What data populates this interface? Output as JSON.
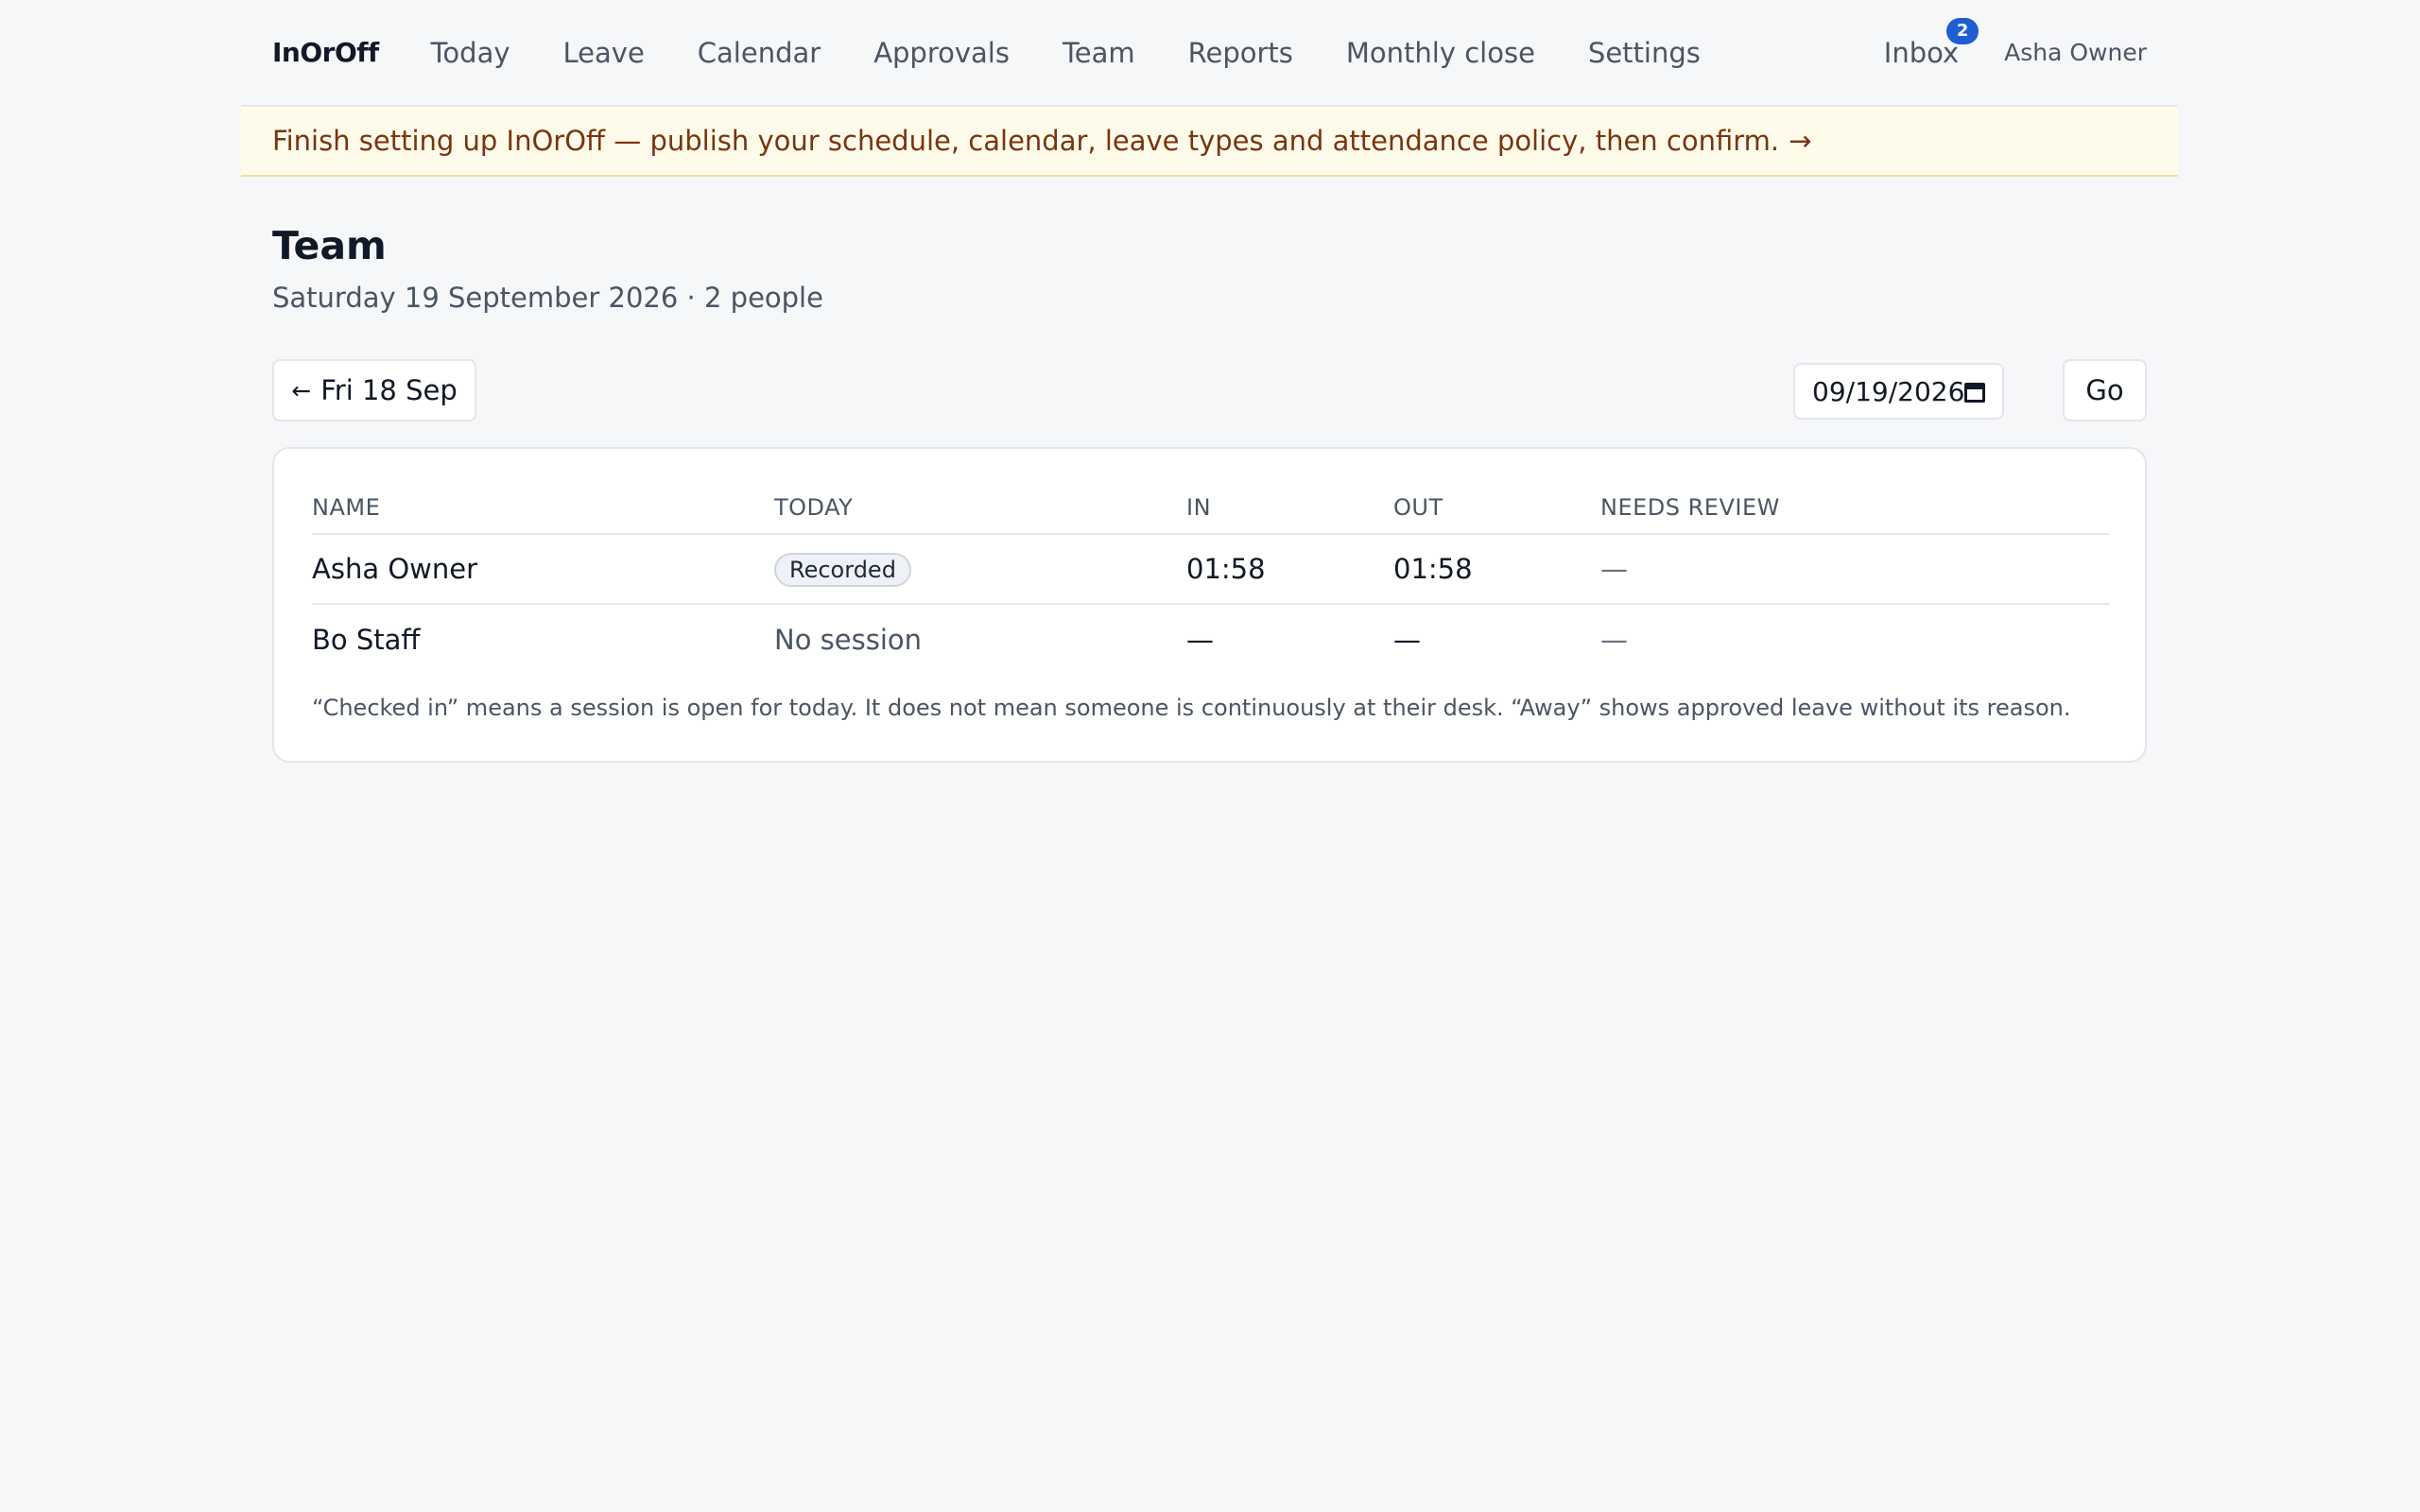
{
  "nav": {
    "brand": "InOrOff",
    "links": [
      "Today",
      "Leave",
      "Calendar",
      "Approvals",
      "Team",
      "Reports",
      "Monthly close",
      "Settings"
    ],
    "inbox_label": "Inbox",
    "inbox_count": "2",
    "user_name": "Asha Owner"
  },
  "banner": {
    "text": "Finish setting up InOrOff — publish your schedule, calendar, leave types and attendance policy, then confirm.",
    "arrow": "→"
  },
  "page": {
    "title": "Team",
    "subtitle": "Saturday 19 September 2026 · 2 people"
  },
  "toolbar": {
    "prev_arrow": "←",
    "prev_label": "Fri 18 Sep",
    "date_value": "09/19/2026",
    "go_label": "Go"
  },
  "table": {
    "headers": [
      "NAME",
      "TODAY",
      "IN",
      "OUT",
      "NEEDS REVIEW"
    ],
    "rows": [
      {
        "name": "Asha Owner",
        "today": "Recorded",
        "in": "01:58",
        "out": "01:58",
        "review": "—"
      },
      {
        "name": "Bo Staff",
        "today": "No session",
        "in": "—",
        "out": "—",
        "review": "—"
      }
    ],
    "note": "“Checked in” means a session is open for today. It does not mean someone is continuously at their desk. “Away” shows approved leave without its reason."
  },
  "colors": {
    "accent": "#1d5fd1",
    "banner_bg": "#fefbea",
    "banner_text": "#7a3410",
    "page_bg": "#f5f7f9"
  }
}
